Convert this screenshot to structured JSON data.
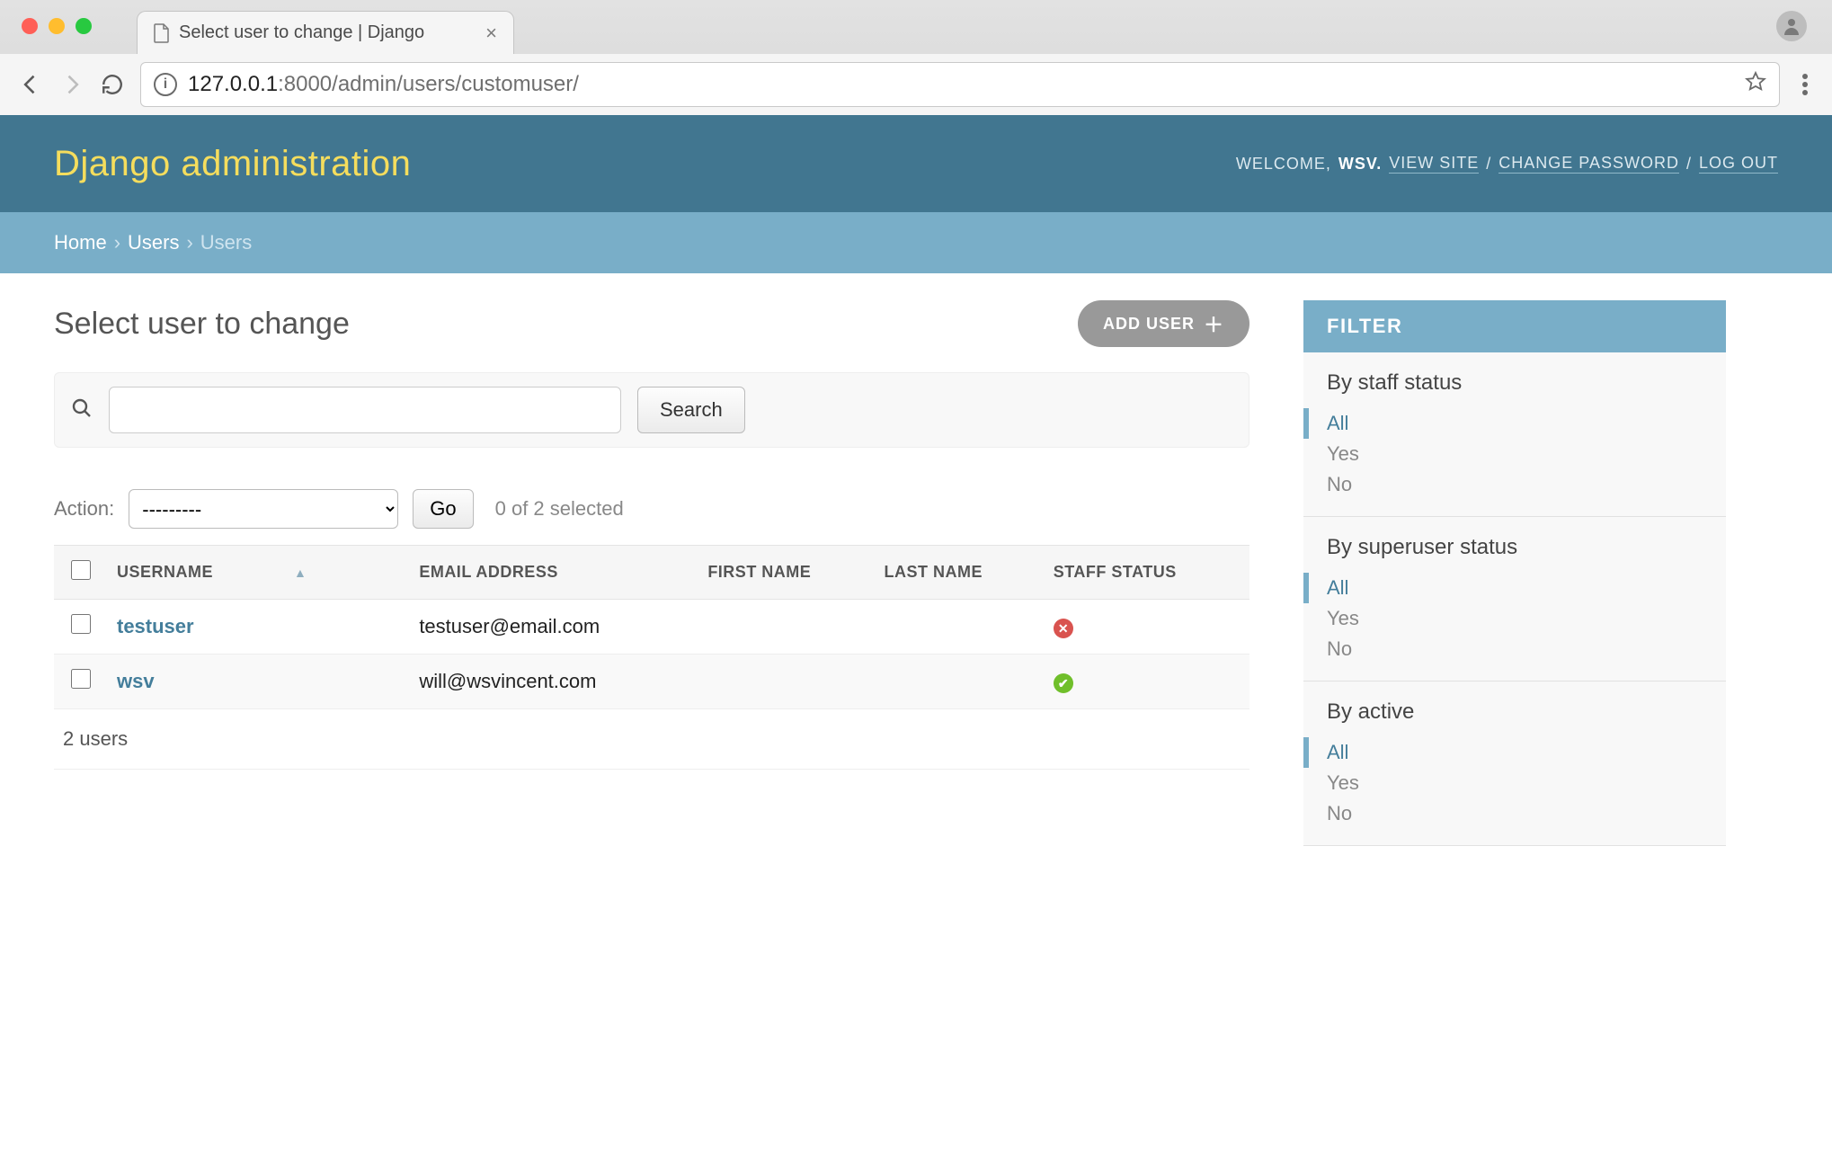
{
  "browser": {
    "tab_title": "Select user to change | Django",
    "url_host": "127.0.0.1",
    "url_port": ":8000",
    "url_path": "/admin/users/customuser/"
  },
  "header": {
    "site_title": "Django administration",
    "welcome_prefix": "WELCOME,",
    "username": "WSV",
    "view_site": "VIEW SITE",
    "change_password": "CHANGE PASSWORD",
    "logout": "LOG OUT"
  },
  "breadcrumbs": {
    "home": "Home",
    "app": "Users",
    "model": "Users"
  },
  "page": {
    "title": "Select user to change",
    "add_button": "ADD USER"
  },
  "search": {
    "button": "Search",
    "value": ""
  },
  "actions": {
    "label": "Action:",
    "placeholder": "---------",
    "go": "Go",
    "selection_text": "0 of 2 selected"
  },
  "table": {
    "columns": {
      "username": "USERNAME",
      "email": "EMAIL ADDRESS",
      "first_name": "FIRST NAME",
      "last_name": "LAST NAME",
      "staff": "STAFF STATUS"
    },
    "rows": [
      {
        "username": "testuser",
        "email": "testuser@email.com",
        "first_name": "",
        "last_name": "",
        "staff": false
      },
      {
        "username": "wsv",
        "email": "will@wsvincent.com",
        "first_name": "",
        "last_name": "",
        "staff": true
      }
    ],
    "count_text": "2 users"
  },
  "filters": {
    "header": "FILTER",
    "groups": [
      {
        "title": "By staff status",
        "options": [
          "All",
          "Yes",
          "No"
        ],
        "selected": "All"
      },
      {
        "title": "By superuser status",
        "options": [
          "All",
          "Yes",
          "No"
        ],
        "selected": "All"
      },
      {
        "title": "By active",
        "options": [
          "All",
          "Yes",
          "No"
        ],
        "selected": "All"
      }
    ]
  }
}
